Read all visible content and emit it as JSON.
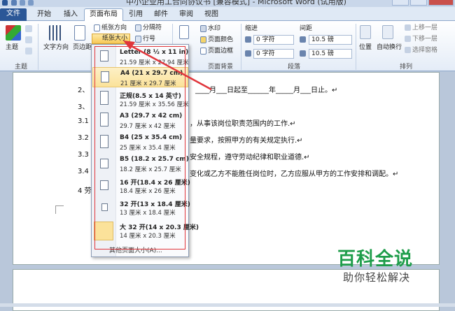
{
  "window": {
    "title": "中小企业用工合同协议书 [兼容模式] - Microsoft Word (试用版)"
  },
  "tabs": {
    "file": "文件",
    "home": "开始",
    "insert": "插入",
    "page_layout": "页面布局",
    "references": "引用",
    "mailings": "邮件",
    "review": "审阅",
    "view": "视图"
  },
  "ribbon": {
    "themes": {
      "theme": "主题",
      "group": "主题"
    },
    "page_setup": {
      "text_direction": "文字方向",
      "margins": "页边距",
      "orientation": "纸张方向",
      "size": "纸张大小",
      "breaks": "分隔符",
      "line_numbers": "行号"
    },
    "page_background": {
      "watermark": "水印",
      "page_color": "页面颜色",
      "page_borders": "页面边框",
      "group": "页面背景"
    },
    "paragraph": {
      "indent": "缩进",
      "spacing": "间距",
      "indent_left": "0 字符",
      "indent_right": "0 字符",
      "spacing_before": "10.5 磅",
      "spacing_after": "10.5 磅",
      "group": "段落"
    },
    "arrange": {
      "position": "位置",
      "wrap_text": "自动换行",
      "bring_forward": "上移一层",
      "send_backward": "下移一层",
      "selection_pane": "选择窗格",
      "group": "排列"
    },
    "accent_color": "#2b5797"
  },
  "paper_menu": {
    "items": [
      {
        "name": "Letter (8 ½ x 11 in)",
        "dims": "21.59 厘米 x 27.94 厘米",
        "selected": false
      },
      {
        "name": "A4 (21 x 29.7 cm)",
        "dims": "21 厘米 x 29.7 厘米",
        "selected": true
      },
      {
        "name": "正规(8.5 x 14 英寸)",
        "dims": "21.59 厘米 x 35.56 厘米",
        "selected": false
      },
      {
        "name": "A3 (29.7 x 42 cm)",
        "dims": "29.7 厘米 x 42 厘米",
        "selected": false
      },
      {
        "name": "B4 (25 x 35.4 cm)",
        "dims": "25 厘米 x 35.4 厘米",
        "selected": false
      },
      {
        "name": "B5 (18.2 x 25.7 cm)",
        "dims": "18.2 厘米 x 25.7 厘米",
        "selected": false
      },
      {
        "name": "16 开(18.4 x 26 厘米)",
        "dims": "18.4 厘米 x 26 厘米",
        "selected": false
      },
      {
        "name": "32 开(13 x 18.4 厘米)",
        "dims": "13 厘米 x 18.4 厘米",
        "selected": false
      },
      {
        "name": "大 32 开(14 x 20.3 厘米)",
        "dims": "14 厘米 x 20.3 厘米",
        "selected": false
      }
    ],
    "more": "其他页面大小(A)..."
  },
  "document": {
    "line2a": "2、",
    "line2b": "____月___日起至______年_____月___日止。↵",
    "line3": "3、",
    "line31a": "3.1",
    "line31b": "，从事该岗位职责范围内的工作.↵",
    "line32a": "3.2",
    "line32b": "量要求，按照甲方的有关规定执行.↵",
    "line33a": "3.3",
    "line33b": "安全规程，遵守劳动纪律和职业道德.↵",
    "line34a": "3.4",
    "line34b": "变化或乙方不能胜任岗位时，乙方应服从甲方的工作安排和调配。↵",
    "line4": "4  劳"
  },
  "watermark": {
    "title": "百科全说",
    "subtitle": "助你轻松解决"
  },
  "highlight_color": "#e0353b"
}
